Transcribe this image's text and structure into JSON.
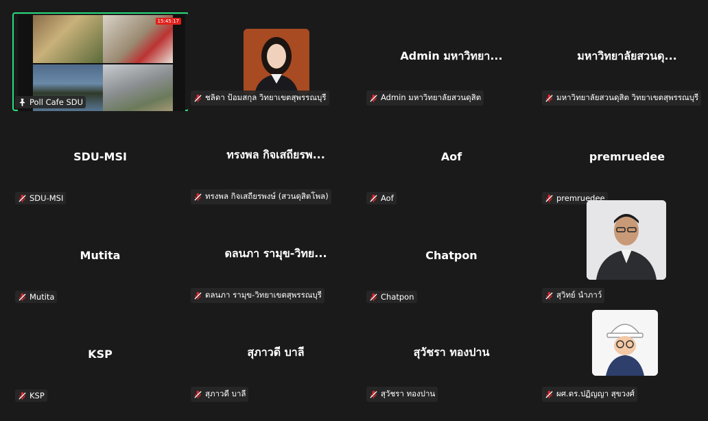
{
  "tiles": [
    {
      "center": "",
      "tag": "Poll Cafe SDU",
      "type": "share"
    },
    {
      "center": "",
      "tag": "ชลิดา  ป้อมสกุล วิทยาเขตสุพรรณบุรี",
      "type": "photo-woman"
    },
    {
      "center": "Admin มหาวิทยา...",
      "tag": "Admin มหาวิทยาลัยสวนดุสิต"
    },
    {
      "center": "มหาวิทยาลัยสวนดุ...",
      "tag": "มหาวิทยาลัยสวนดุสิต วิทยาเขตสุพรรณบุรี"
    },
    {
      "center": "SDU-MSI",
      "tag": "SDU-MSI"
    },
    {
      "center": "ทรงพล กิจเสถียรพ...",
      "tag": "ทรงพล กิจเสถียรพงษ์ (สวนดุสิตโพล)"
    },
    {
      "center": "Aof",
      "tag": "Aof"
    },
    {
      "center": "premruedee",
      "tag": "premruedee"
    },
    {
      "center": "Mutita",
      "tag": "Mutita"
    },
    {
      "center": "ดลนภา รามุข-วิทย...",
      "tag": "ดลนภา รามุข-วิทยาเขตสุพรรณบุรี"
    },
    {
      "center": "Chatpon",
      "tag": "Chatpon"
    },
    {
      "center": "",
      "tag": "สุวิทย์ นำภาว์",
      "type": "photo-man"
    },
    {
      "center": "KSP",
      "tag": "KSP"
    },
    {
      "center": "สุภาวดี บาลี",
      "tag": "สุภาวดี บาลี"
    },
    {
      "center": "สุวัชรา ทองปาน",
      "tag": "สุวัชรา ทองปาน"
    },
    {
      "center": "",
      "tag": "ผศ.ดร.ปฏิญญา สุขวงศ์",
      "type": "photo-cartoon"
    }
  ],
  "recording_time": "15:45:17",
  "colors": {
    "active_border": "#29e07d",
    "mute_red": "#e0262e",
    "background": "#1a1a1a"
  }
}
